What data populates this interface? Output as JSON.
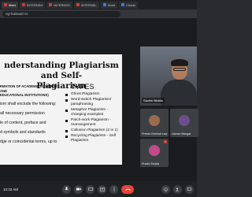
{
  "browser": {
    "tabs": [
      {
        "label": "Meet"
      },
      {
        "label": "INTERNSH"
      },
      {
        "label": "INTERNSH"
      },
      {
        "label": "INTERNAL"
      },
      {
        "label": "Hood"
      },
      {
        "label": "Charts"
      }
    ],
    "url": "ng-fcabuam-ix"
  },
  "slide": {
    "title_line1": "nderstanding Plagiarism and Self-",
    "title_line2": "Plagiarism",
    "source_line1": "RMATION OF ACADEMIC INTEGRITY AND",
    "source_line2": "EDUCATIONAL INSTITUTIONS)",
    "left_items": [
      "ism shall exclude the following:",
      "all necessary permission",
      "le of content, preface and",
      "d symbols and standards",
      "dge or coincidental terms, up to"
    ],
    "types_heading": "TYPES",
    "types_items": [
      "Ghost Plagiarism",
      "Word-switch Plagiarism/ paraphrasing",
      "Metaphor Plagiarism - changing examples",
      "Patch-work Plagiarism - rearrangement",
      "Collusion Plagiarism (2 in 1)",
      "Recycling Plagiarism - Self Plagiarism"
    ]
  },
  "speaker": {
    "name": "Sachin Bhatia"
  },
  "participants": [
    {
      "name": "Preeta Criminal Law",
      "color": "#9c6b4e"
    },
    {
      "name": "Usman Mangal",
      "color": "#6a4f8c"
    },
    {
      "name": "Prachi Shukla",
      "color": "#c04a8a"
    }
  ],
  "controls": {
    "time": "10:33 AM"
  }
}
